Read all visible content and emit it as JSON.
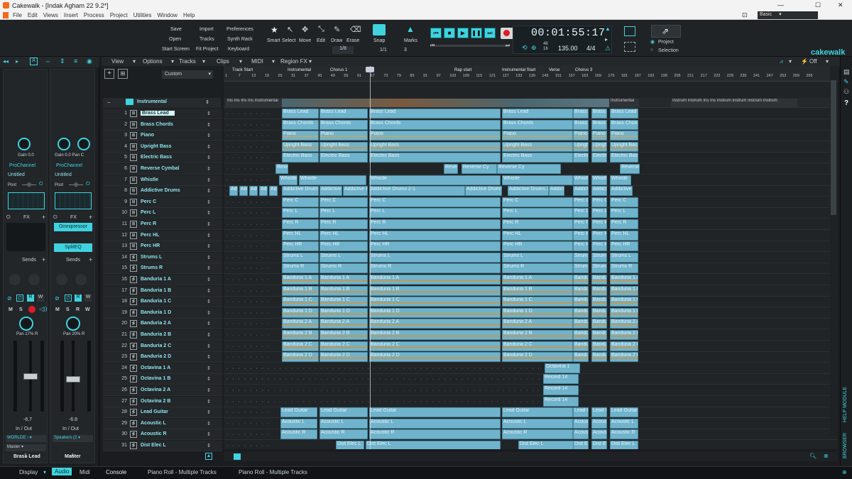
{
  "window": {
    "title": "Cakewalk - [Indak Agham 22 9.2*]",
    "controls": [
      "—",
      "☐",
      "✕"
    ]
  },
  "menu": [
    "File",
    "Edit",
    "Views",
    "Insert",
    "Process",
    "Project",
    "Utilities",
    "Window",
    "Help"
  ],
  "workspace": "Basic",
  "file_buttons": {
    "save": "Save",
    "open": "Open",
    "start_screen": "Start Screen",
    "import": "Import",
    "tracks": "Tracks",
    "fit_project": "Fit Project",
    "preferences": "Preferences",
    "synth_rack": "Synth Rack",
    "keyboard": "Keyboard"
  },
  "tools": {
    "smart": "Smart",
    "select": "Select",
    "move": "Move",
    "edit": "Edit",
    "draw": "Draw",
    "erase": "Erase",
    "grid_value": "1/8"
  },
  "snap": {
    "label": "Snap",
    "marks_label": "Marks",
    "value": "1/1",
    "marks_count": "3"
  },
  "transport": {
    "time": "00:01:55:17",
    "tempo": "135.00",
    "meter": "4/4",
    "meter_top": "48",
    "meter_bottom": "16"
  },
  "export": {
    "project": "Project",
    "selection": "Selection"
  },
  "brand": "cakewalk",
  "view_menu": {
    "view": "View",
    "options": "Options",
    "tracks": "Tracks",
    "clips": "Clips",
    "midi": "MIDI",
    "region_fx": "Region FX",
    "off": "Off"
  },
  "track_filter": "Custom",
  "folder": {
    "name": "Instrumental"
  },
  "markers": [
    "Track Start",
    "Instrumental",
    "Chorus 1",
    "Rap start",
    "Instrumental Start",
    "Verse",
    "Chorus 3"
  ],
  "ruler_numbers": [
    "1",
    "7",
    "13",
    "19",
    "25",
    "31",
    "37",
    "43",
    "49",
    "55",
    "61",
    "67",
    "73",
    "79",
    "85",
    "91",
    "97",
    "103",
    "109",
    "115",
    "121",
    "127",
    "133",
    "139",
    "145",
    "151",
    "157",
    "163",
    "169",
    "175",
    "181",
    "187",
    "193",
    "199",
    "205",
    "211",
    "217",
    "223",
    "229",
    "235",
    "241",
    "247",
    "253",
    "259",
    "265"
  ],
  "tracks": [
    {
      "num": "1",
      "name": "Brass Lead",
      "clip": "Brass Lead"
    },
    {
      "num": "2",
      "name": "Brass Chords",
      "clip": "Brass Chords"
    },
    {
      "num": "3",
      "name": "Piano",
      "clip": "Piano"
    },
    {
      "num": "4",
      "name": "Upright Bass",
      "clip": "Upright Bass"
    },
    {
      "num": "5",
      "name": "Electric Bass",
      "clip": "Electric Bass"
    },
    {
      "num": "6",
      "name": "Reverse Cymbal",
      "clip": "Reverse Cy"
    },
    {
      "num": "7",
      "name": "Whistle",
      "clip": "Whistle"
    },
    {
      "num": "8",
      "name": "Addictive Drums",
      "clip": "Addictive Drums 2-1"
    },
    {
      "num": "9",
      "name": "Perc C",
      "clip": "Perc C"
    },
    {
      "num": "10",
      "name": "Perc L",
      "clip": "Perc L"
    },
    {
      "num": "11",
      "name": "Perc R",
      "clip": "Perc R"
    },
    {
      "num": "12",
      "name": "Perc HL",
      "clip": "Perc HL"
    },
    {
      "num": "13",
      "name": "Perc HR",
      "clip": "Perc HR"
    },
    {
      "num": "14",
      "name": "Strums L",
      "clip": "Strums L"
    },
    {
      "num": "15",
      "name": "Strums R",
      "clip": "Strums R"
    },
    {
      "num": "16",
      "name": "Banduria 1 A",
      "clip": "Banduria 1 A"
    },
    {
      "num": "17",
      "name": "Banduria 1 B",
      "clip": "Banduria 1 B"
    },
    {
      "num": "18",
      "name": "Banduria 1 C",
      "clip": "Banduria 1 C"
    },
    {
      "num": "19",
      "name": "Banduria 1 D",
      "clip": "Banduria 1 D"
    },
    {
      "num": "20",
      "name": "Banduria 2 A",
      "clip": "Banduria 2 A"
    },
    {
      "num": "21",
      "name": "Banduria 2 B",
      "clip": "Banduria 2 B"
    },
    {
      "num": "22",
      "name": "Banduria 2 C",
      "clip": "Banduria 2 C"
    },
    {
      "num": "23",
      "name": "Banduria 2 D",
      "clip": "Banduria 2 D"
    },
    {
      "num": "24",
      "name": "Octavina 1 A",
      "clip": "Octavina 1"
    },
    {
      "num": "25",
      "name": "Octavina 1 B",
      "clip": "Record 14"
    },
    {
      "num": "26",
      "name": "Octavina 2 A",
      "clip": "Record 14"
    },
    {
      "num": "27",
      "name": "Octavina 2 B",
      "clip": "Record 14"
    },
    {
      "num": "28",
      "name": "Lead Guitar",
      "clip": "Lead Guitar"
    },
    {
      "num": "29",
      "name": "Acoustic L",
      "clip": "Acoustic L"
    },
    {
      "num": "30",
      "name": "Acoustic R",
      "clip": "Acoustic R"
    },
    {
      "num": "31",
      "name": "Dist Elec L",
      "clip": "Dist Elec L"
    }
  ],
  "inspector": {
    "gain_label": "Gain",
    "gain_value": "0.0",
    "pan_label": "Pan",
    "pan_c": "C",
    "prochannel": "ProChannel",
    "untitled": "Untitled",
    "post": "Post",
    "fx": "FX",
    "fx_plugins": [
      "Omnipressor",
      "SplitEQ"
    ],
    "sends": "Sends",
    "pan_left": "Pan 17% R",
    "pan_right": "Pan 20% R",
    "vol_left": "-6.7",
    "vol_right": "-6.8",
    "in_out": "In / Out",
    "input_left": "WORLDE -",
    "input_right": "Speakers (2",
    "output_left": "Master",
    "strip_left_name": "Brass Lead",
    "strip_left_num": "1",
    "strip_right_name": "Master",
    "strip_right_num": "A",
    "msr": [
      "M",
      "S",
      "R",
      "W"
    ]
  },
  "bottom_tabs": {
    "display": "Display",
    "audio": "Audio",
    "midi": "Midi",
    "console": "Console",
    "piano_roll_1": "Piano Roll - Multiple Tracks",
    "piano_roll_2": "Piano Roll - Multiple Tracks"
  },
  "side_labels": {
    "browser": "BROWSER",
    "help": "HELP MODULE"
  }
}
